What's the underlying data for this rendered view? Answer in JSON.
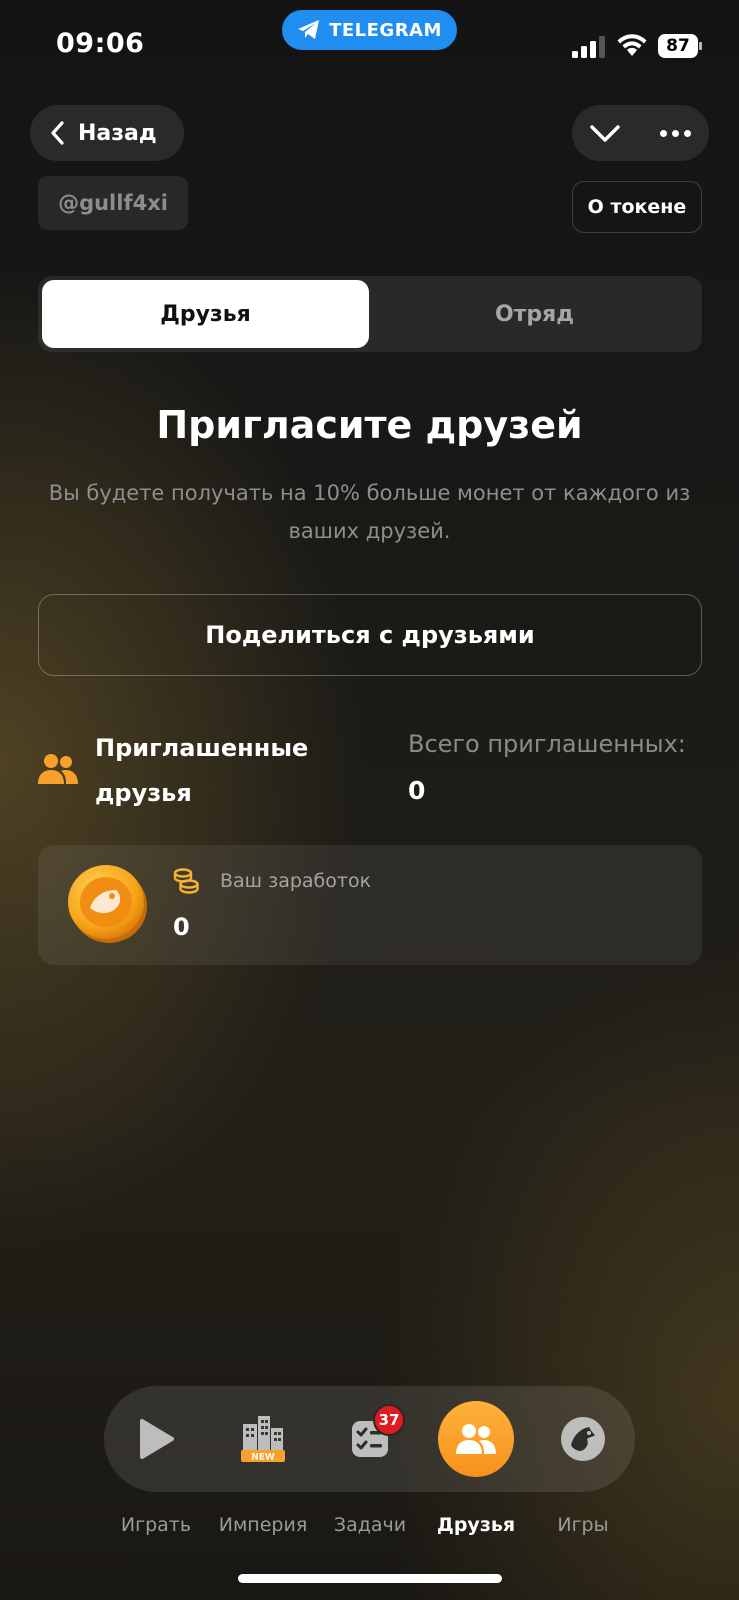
{
  "status_bar": {
    "time": "09:06",
    "telegram_label": "TELEGRAM",
    "battery": "87"
  },
  "nav": {
    "back_label": "Назад"
  },
  "account": {
    "username": "@gullf4xi",
    "token_button": "О токене"
  },
  "tabs": [
    {
      "label": "Друзья",
      "active": true
    },
    {
      "label": "Отряд",
      "active": false
    }
  ],
  "invite": {
    "title": "Пригласите друзей",
    "subtitle": "Вы будете получать на 10% больше монет от каждого из ваших друзей.",
    "share_button": "Поделиться с друзьями"
  },
  "invited": {
    "label": "Приглашенные друзья",
    "total_label": "Всего приглашенных:",
    "total_value": "0"
  },
  "earnings": {
    "label": "Ваш заработок",
    "value": "0"
  },
  "bottom_nav": {
    "items": [
      {
        "label": "Играть",
        "icon": "play-icon"
      },
      {
        "label": "Империя",
        "icon": "empire-icon",
        "badge": "NEW"
      },
      {
        "label": "Задачи",
        "icon": "tasks-icon",
        "count": "37"
      },
      {
        "label": "Друзья",
        "icon": "friends-icon",
        "active": true
      },
      {
        "label": "Игры",
        "icon": "games-icon"
      }
    ]
  },
  "colors": {
    "accent": "#f7a12a",
    "telegram": "#1f8ef0",
    "badge": "#e2191f"
  }
}
